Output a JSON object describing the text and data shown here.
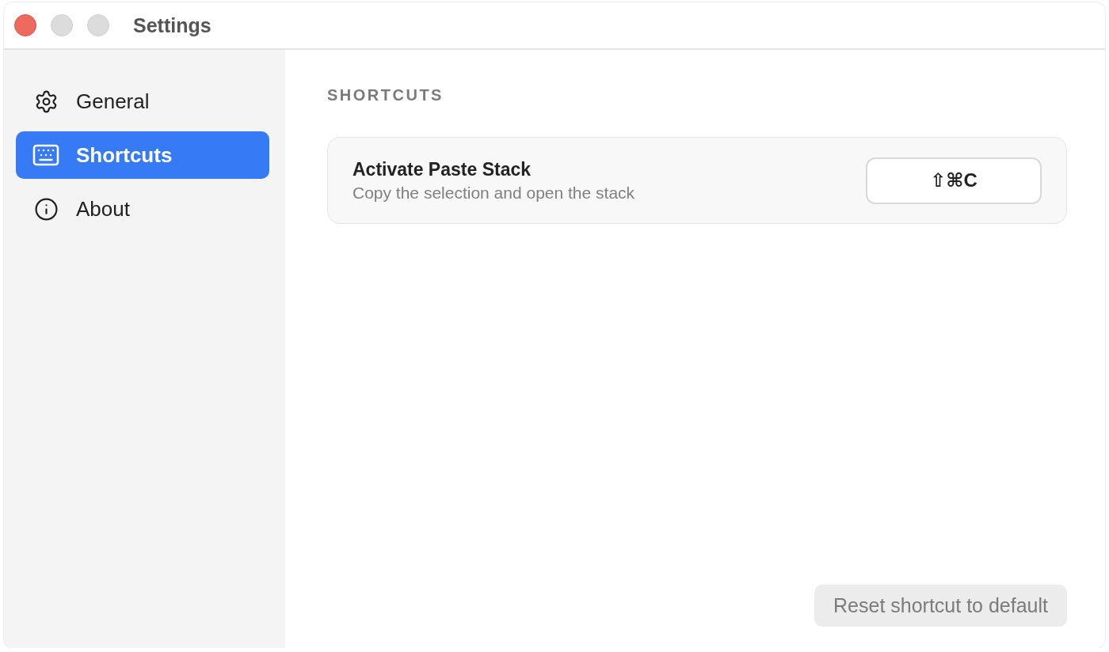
{
  "window": {
    "title": "Settings",
    "traffic_lights": [
      {
        "kind": "close",
        "disabled": false
      },
      {
        "kind": "minimize",
        "disabled": true
      },
      {
        "kind": "zoom",
        "disabled": true
      }
    ]
  },
  "sidebar": {
    "items": [
      {
        "label": "General",
        "selected": false
      },
      {
        "label": "Shortcuts",
        "selected": true
      },
      {
        "label": "About",
        "selected": false
      }
    ]
  },
  "section": {
    "heading": "SHORTCUTS",
    "shortcuts": [
      {
        "title": "Activate Paste Stack",
        "description": "Copy the selection and open the stack",
        "keys": "⇧⌘C"
      }
    ]
  },
  "reset_button": {
    "label": "Reset shortcut to default",
    "disabled": true
  }
}
